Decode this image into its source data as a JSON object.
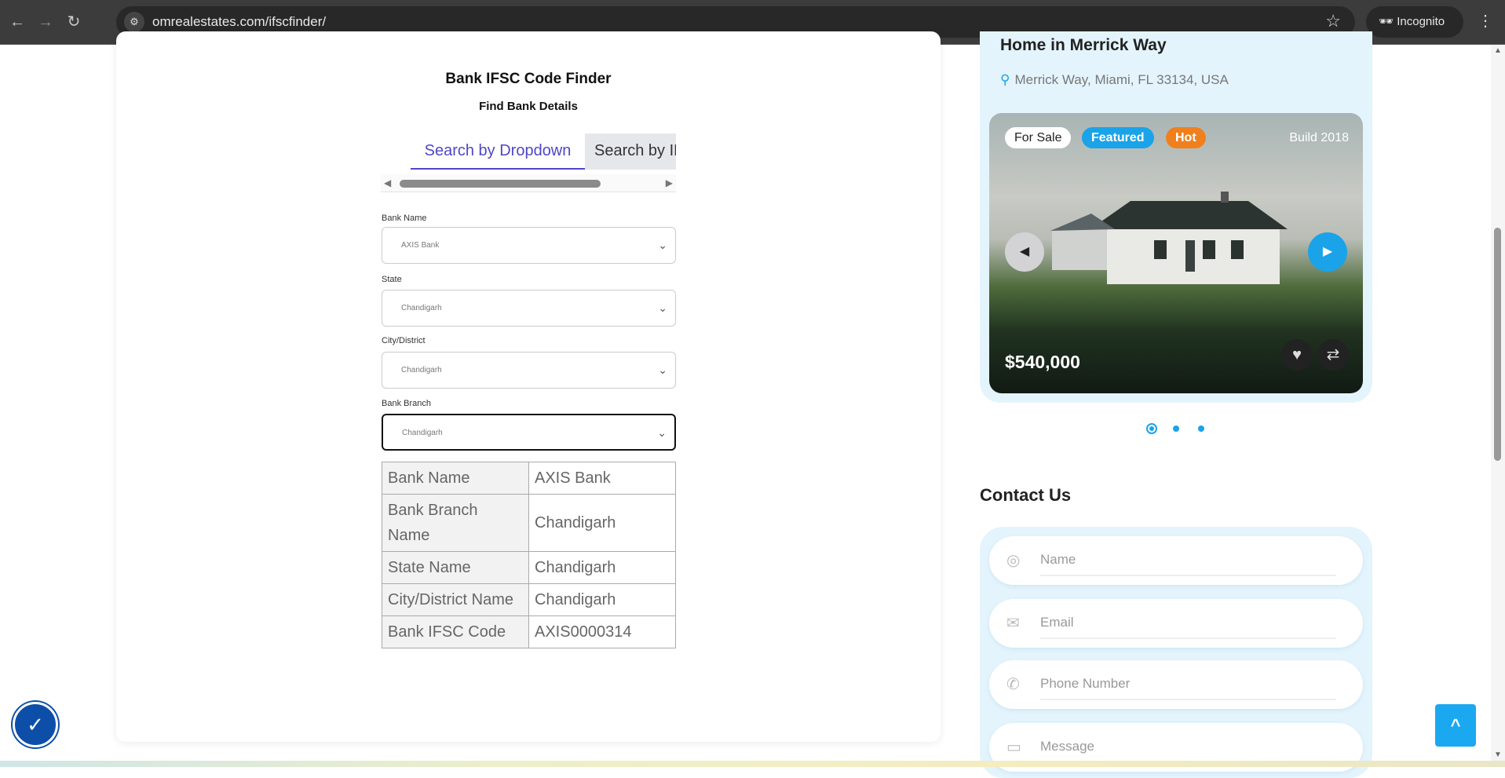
{
  "browser": {
    "url": "omrealestates.com/ifscfinder/",
    "profile": "Incognito"
  },
  "finder": {
    "title": "Bank IFSC Code Finder",
    "subtitle": "Find Bank Details",
    "tabs": [
      {
        "label": "Search by Dropdown",
        "active": true
      },
      {
        "label": "Search by IFSC",
        "active": false
      }
    ],
    "fields": [
      {
        "label": "Bank Name",
        "value": "AXIS Bank"
      },
      {
        "label": "State",
        "value": "Chandigarh"
      },
      {
        "label": "City/District",
        "value": "Chandigarh"
      },
      {
        "label": "Bank Branch",
        "value": "Chandigarh"
      }
    ],
    "results": [
      {
        "key": "Bank Name",
        "value": "AXIS Bank"
      },
      {
        "key": "Bank Branch Name",
        "value": "Chandigarh"
      },
      {
        "key": "State Name",
        "value": "Chandigarh"
      },
      {
        "key": "City/District Name",
        "value": "Chandigarh"
      },
      {
        "key": "Bank IFSC Code",
        "value": "AXIS0000314"
      }
    ]
  },
  "listing": {
    "title": "Home in Merrick Way",
    "address": "Merrick Way, Miami, FL 33134, USA",
    "badges": {
      "sale": "For Sale",
      "featured": "Featured",
      "hot": "Hot",
      "build": "Build 2018"
    },
    "price": "$540,000",
    "slide_current": 1,
    "slide_total": 3
  },
  "contact": {
    "title": "Contact Us",
    "placeholders": {
      "name": "Name",
      "email": "Email",
      "phone": "Phone Number",
      "message": "Message"
    }
  },
  "colors": {
    "accent": "#1aa3e8",
    "tab": "#5046c8",
    "hot": "#f0801e"
  }
}
